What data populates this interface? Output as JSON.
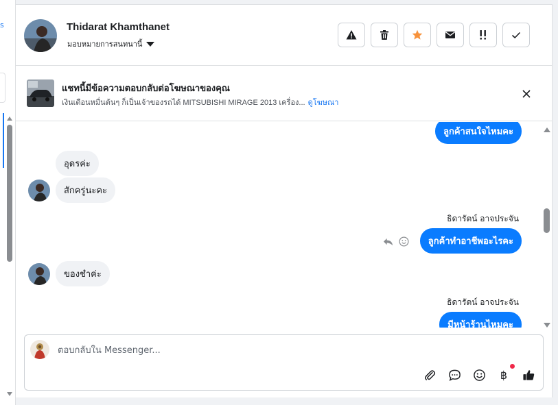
{
  "left_panel": {
    "fragment_text": "s"
  },
  "header": {
    "contact_name": "Thidarat Khamthanet",
    "assign_label": "มอบหมายการสนทนานี้",
    "actions": [
      {
        "name": "spam-button",
        "icon": "warning-icon"
      },
      {
        "name": "delete-button",
        "icon": "trash-icon"
      },
      {
        "name": "star-button",
        "icon": "star-icon"
      },
      {
        "name": "mark-unread-button",
        "icon": "envelope-icon"
      },
      {
        "name": "follow-up-button",
        "icon": "exclamation-icon"
      },
      {
        "name": "mark-done-button",
        "icon": "check-icon"
      }
    ],
    "star_color": "#f7923b"
  },
  "ad_banner": {
    "title": "แชทนี้มีข้อความตอบกลับต่อโฆษณาของคุณ",
    "description": "เงินเดือนหมื่นต้นๆ ก็เป็นเจ้าของรถได้ MITSUBISHI MIRAGE 2013 เครื่อง...",
    "link": "ดูโฆษณา"
  },
  "messages": [
    {
      "direction": "out",
      "text": "ลูกค้าสนใจไหมคะ"
    },
    {
      "direction": "in",
      "text": "อุดรค่ะ"
    },
    {
      "direction": "in",
      "text": "สักครู่นะคะ"
    },
    {
      "direction": "out",
      "sender": "ธิดารัตน์ อาจประจัน",
      "text": "ลูกค้าทำอาชีพอะไรคะ"
    },
    {
      "direction": "in",
      "text": "ของชำค่ะ"
    },
    {
      "direction": "out",
      "sender": "ธิดารัตน์ อาจประจัน",
      "text": "มีหน้าร้านไหมคะ"
    }
  ],
  "composer": {
    "placeholder": "ตอบกลับใน Messenger...",
    "value": "",
    "currency_symbol": "฿"
  },
  "colors": {
    "accent": "#1877f2",
    "outgoing_bubble": "#0a7cff",
    "incoming_bubble": "#f0f2f5",
    "notification_dot": "#f02849"
  }
}
